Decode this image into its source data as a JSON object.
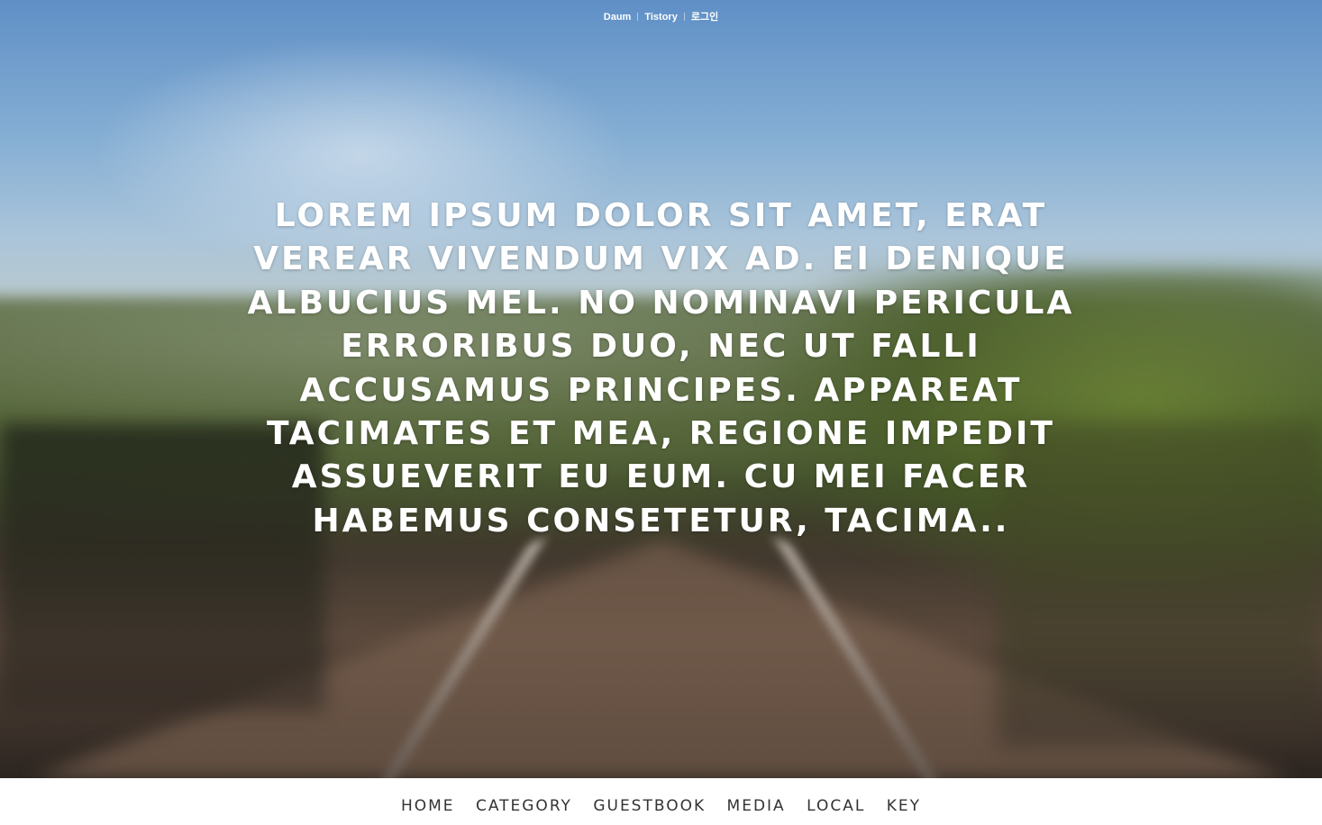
{
  "topbar": {
    "links": [
      "Daum",
      "Tistory",
      "로그인"
    ]
  },
  "hero": {
    "headline": "LOREM IPSUM DOLOR SIT AMET, ERAT VEREAR VIVENDUM VIX AD. EI DENIQUE ALBUCIUS MEL. NO NOMINAVI PERICULA ERRORIBUS DUO, NEC UT FALLI ACCUSAMUS PRINCIPES. APPAREAT TACIMATES ET MEA, REGIONE IMPEDIT ASSUEVERIT EU EUM. CU MEI FACER HABEMUS CONSETETUR, TACIMA.."
  },
  "nav": {
    "items": [
      "HOME",
      "CATEGORY",
      "GUESTBOOK",
      "MEDIA",
      "LOCAL",
      "KEY"
    ]
  },
  "colors": {
    "headline_text": "#ffffff",
    "nav_text": "#333333",
    "nav_background": "#ffffff"
  }
}
